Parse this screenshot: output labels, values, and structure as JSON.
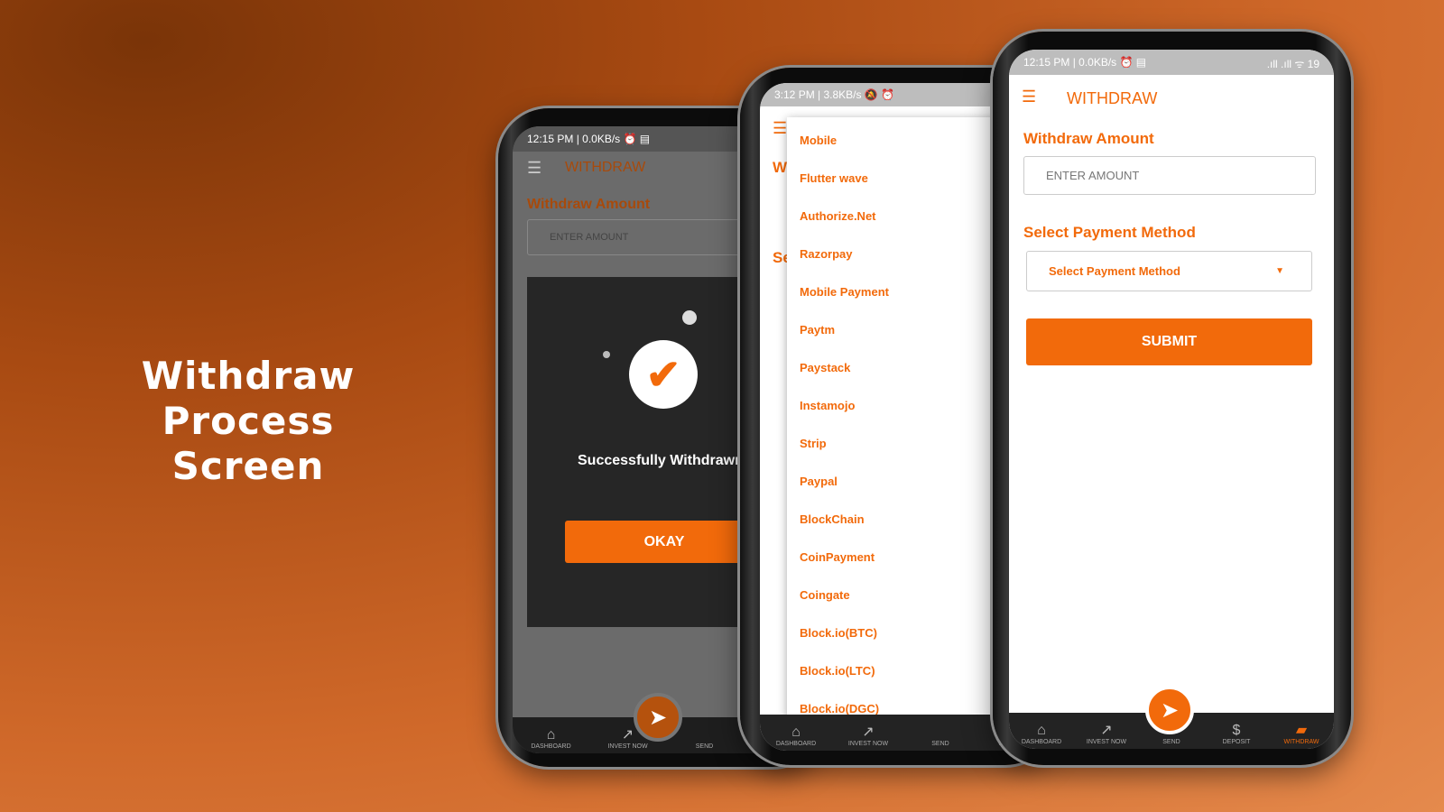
{
  "headline": {
    "line1": "Withdraw Process",
    "line2": "Screen"
  },
  "colors": {
    "accent": "#f26a0b",
    "nav_bg": "#232323"
  },
  "nav": [
    {
      "label": "DASHBOARD",
      "icon": "home-icon"
    },
    {
      "label": "INVEST NOW",
      "icon": "trend-up-icon"
    },
    {
      "label": "SEND",
      "icon": "paper-plane-icon"
    },
    {
      "label": "DEPOSIT",
      "icon": "dollar-icon"
    },
    {
      "label": "WITHDRAW",
      "icon": "wallet-icon"
    }
  ],
  "phone1": {
    "status": "12:15 PM | 0.0KB/s ⏰ ▤",
    "title": "WITHDRAW",
    "amount_label": "Withdraw Amount",
    "amount_placeholder": "ENTER AMOUNT",
    "dialog_message": "Successfully Withdrawn",
    "ok": "OKAY"
  },
  "phone2": {
    "status": "3:12 PM | 3.8KB/s 🔕 ⏰",
    "partial1": "W",
    "partial2": "Se",
    "options": [
      "Mobile",
      "Flutter wave",
      "Authorize.Net",
      "Razorpay",
      "Mobile Payment",
      "Paytm",
      "Paystack",
      "Instamojo",
      "Strip",
      "Paypal",
      "BlockChain",
      "CoinPayment",
      "Coingate",
      "Block.io(BTC)",
      "Block.io(LTC)",
      "Block.io(DGC)"
    ]
  },
  "phone3": {
    "status": "12:15 PM | 0.0KB/s ⏰ ▤",
    "status_right": ".ıll .ıll ᯤ 19",
    "title": "WITHDRAW",
    "amount_label": "Withdraw Amount",
    "amount_placeholder": "ENTER AMOUNT",
    "method_label": "Select Payment Method",
    "method_value": "Select Payment Method",
    "submit": "SUBMIT"
  }
}
